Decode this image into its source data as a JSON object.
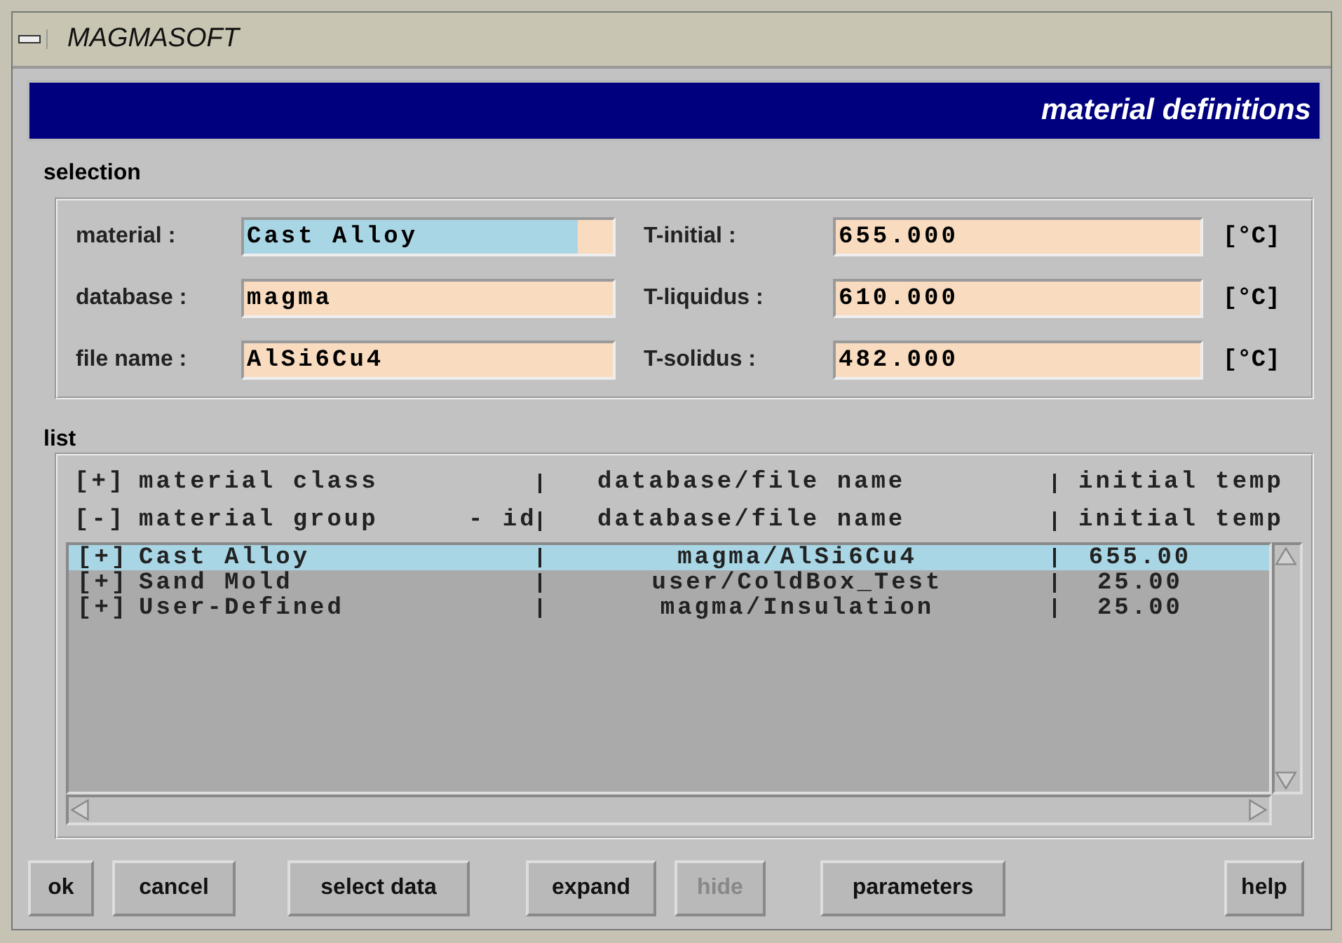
{
  "window": {
    "title": "MAGMASOFT"
  },
  "header": {
    "title": "material definitions"
  },
  "selection": {
    "label": "selection",
    "fields": [
      {
        "label": "material :",
        "value": "Cast Alloy",
        "highlighted": true
      },
      {
        "label": "T-initial :",
        "value": "655.000",
        "unit": "[°C]",
        "highlighted": false
      },
      {
        "label": "database :",
        "value": "magma",
        "highlighted": false
      },
      {
        "label": "T-liquidus :",
        "value": "610.000",
        "unit": "[°C]",
        "highlighted": false
      },
      {
        "label": "file name :",
        "value": "AlSi6Cu4",
        "highlighted": false
      },
      {
        "label": "T-solidus :",
        "value": "482.000",
        "unit": "[°C]",
        "highlighted": false
      }
    ]
  },
  "list": {
    "label": "list",
    "headers": [
      {
        "marker": "[+]",
        "name": "material class",
        "path": "database/file name",
        "temp": "initial temp"
      },
      {
        "marker": "[-]",
        "name": "material group",
        "id": "- id",
        "path": "database/file name",
        "temp": "initial temp"
      }
    ],
    "rows": [
      {
        "marker": "[+]",
        "name": "Cast Alloy",
        "path": "magma/AlSi6Cu4",
        "temp": "655.00",
        "selected": true
      },
      {
        "marker": "[+]",
        "name": "Sand Mold",
        "path": "user/ColdBox_Test",
        "temp": "25.00",
        "selected": false
      },
      {
        "marker": "[+]",
        "name": "User-Defined",
        "path": "magma/Insulation",
        "temp": "25.00",
        "selected": false
      }
    ]
  },
  "buttons": [
    {
      "label": "ok",
      "disabled": false
    },
    {
      "label": "cancel",
      "disabled": false
    },
    {
      "label": "select data",
      "disabled": false
    },
    {
      "label": "expand",
      "disabled": false
    },
    {
      "label": "hide",
      "disabled": true
    },
    {
      "label": "parameters",
      "disabled": false
    },
    {
      "label": "help",
      "disabled": false
    }
  ]
}
